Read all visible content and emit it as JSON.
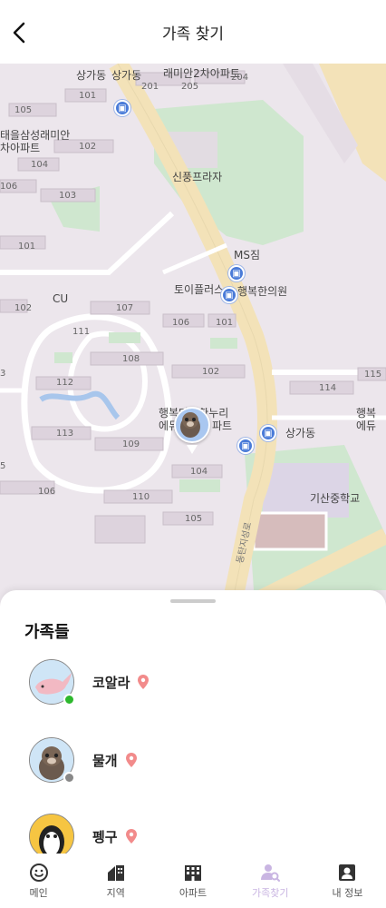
{
  "header": {
    "title": "가족 찾기"
  },
  "map": {
    "labels": {
      "top_store1": "상가동",
      "top_store2": "상가동",
      "top_apt": "래미안2차아파트",
      "left_apt_line1": "래미안",
      "left_apt_line1_prefix": "태을삼성",
      "left_apt_line2": "차아파트",
      "shinpoong": "신풍프라자",
      "ms": "MS짐",
      "toy": "토이플러스",
      "clinic": "행복한의원",
      "cu": "CU",
      "apt_center_line1": "행복마을한누리",
      "apt_center_line2": "에듀",
      "apt_center_line2b": "파트",
      "store_right": "상가동",
      "right_apt_line1": "행복",
      "right_apt_line2": "에듀",
      "school": "기산중학교",
      "road": "동탄지성로"
    },
    "buildings": [
      "101",
      "105",
      "102",
      "104",
      "106",
      "103",
      "201",
      "205",
      "204",
      "101",
      "102",
      "107",
      "111",
      "106",
      "101",
      "108",
      "112",
      "102",
      "113",
      "109",
      "114",
      "115",
      "104",
      "110",
      "105",
      "106",
      "3",
      "5"
    ]
  },
  "sheet": {
    "title": "가족들",
    "members": [
      {
        "name": "코알라",
        "status_color": "#2db82d",
        "avatar": "whale-avatar"
      },
      {
        "name": "물개",
        "status_color": "#888888",
        "avatar": "otter-avatar"
      },
      {
        "name": "펭구",
        "status_color": "",
        "avatar": "penguin-avatar"
      }
    ]
  },
  "nav": [
    {
      "label": "메인",
      "icon": "smile-icon"
    },
    {
      "label": "지역",
      "icon": "home-region-icon"
    },
    {
      "label": "아파트",
      "icon": "apartment-icon"
    },
    {
      "label": "가족찾기",
      "icon": "family-search-icon",
      "active": true
    },
    {
      "label": "내 정보",
      "icon": "profile-icon"
    }
  ],
  "colors": {
    "accent": "#c9b5e2",
    "map_bg": "#ece6ec",
    "road": "#f3e2b8",
    "park": "#cfe7cf",
    "pin": "#f28b8b"
  }
}
